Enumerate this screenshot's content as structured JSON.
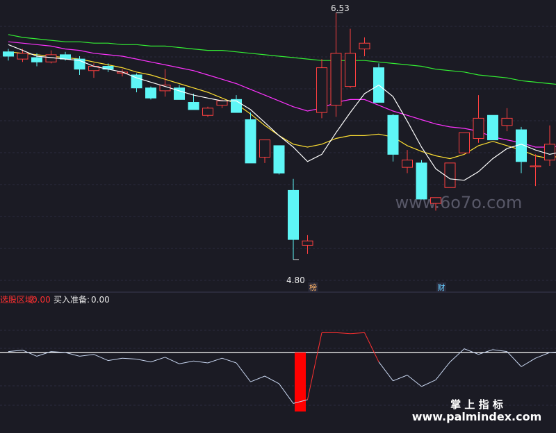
{
  "chart_data": [
    {
      "type": "candlestick",
      "price_high_label": "6.53",
      "price_low_label": "4.80",
      "ylim": [
        4.6,
        6.6
      ],
      "colors": {
        "up": "#ff4040",
        "down": "#5ef6f6",
        "ma5": "#ffffff",
        "ma10": "#ffe033",
        "ma20": "#ff33ff",
        "ma60": "#33ee33"
      },
      "candles": [
        {
          "o": 6.26,
          "h": 6.28,
          "l": 6.2,
          "c": 6.23
        },
        {
          "o": 6.21,
          "h": 6.28,
          "l": 6.19,
          "c": 6.25
        },
        {
          "o": 6.22,
          "h": 6.25,
          "l": 6.16,
          "c": 6.19
        },
        {
          "o": 6.19,
          "h": 6.27,
          "l": 6.18,
          "c": 6.24
        },
        {
          "o": 6.24,
          "h": 6.26,
          "l": 6.2,
          "c": 6.21
        },
        {
          "o": 6.21,
          "h": 6.23,
          "l": 6.1,
          "c": 6.14
        },
        {
          "o": 6.13,
          "h": 6.18,
          "l": 6.08,
          "c": 6.16
        },
        {
          "o": 6.16,
          "h": 6.18,
          "l": 6.12,
          "c": 6.14
        },
        {
          "o": 6.12,
          "h": 6.14,
          "l": 6.09,
          "c": 6.12
        },
        {
          "o": 6.1,
          "h": 6.11,
          "l": 5.98,
          "c": 6.01
        },
        {
          "o": 6.01,
          "h": 6.02,
          "l": 5.93,
          "c": 5.94
        },
        {
          "o": 5.99,
          "h": 6.14,
          "l": 5.95,
          "c": 6.03
        },
        {
          "o": 6.01,
          "h": 6.03,
          "l": 5.93,
          "c": 5.93
        },
        {
          "o": 5.91,
          "h": 5.97,
          "l": 5.86,
          "c": 5.86
        },
        {
          "o": 5.82,
          "h": 5.88,
          "l": 5.81,
          "c": 5.87
        },
        {
          "o": 5.89,
          "h": 5.93,
          "l": 5.87,
          "c": 5.92
        },
        {
          "o": 5.93,
          "h": 5.96,
          "l": 5.84,
          "c": 5.84
        },
        {
          "o": 5.79,
          "h": 5.84,
          "l": 5.49,
          "c": 5.49
        },
        {
          "o": 5.53,
          "h": 5.65,
          "l": 5.49,
          "c": 5.65
        },
        {
          "o": 5.61,
          "h": 5.61,
          "l": 5.41,
          "c": 5.42
        },
        {
          "o": 5.3,
          "h": 5.38,
          "l": 4.82,
          "c": 4.96
        },
        {
          "o": 4.92,
          "h": 4.99,
          "l": 4.86,
          "c": 4.95
        },
        {
          "o": 5.84,
          "h": 6.21,
          "l": 5.8,
          "c": 6.15
        },
        {
          "o": 5.89,
          "h": 6.53,
          "l": 5.81,
          "c": 6.25
        },
        {
          "o": 6.02,
          "h": 6.42,
          "l": 6.01,
          "c": 6.25
        },
        {
          "o": 6.28,
          "h": 6.36,
          "l": 6.23,
          "c": 6.32
        },
        {
          "o": 6.15,
          "h": 6.18,
          "l": 5.91,
          "c": 5.91
        },
        {
          "o": 5.82,
          "h": 5.83,
          "l": 5.5,
          "c": 5.55
        },
        {
          "o": 5.46,
          "h": 5.58,
          "l": 5.42,
          "c": 5.51
        },
        {
          "o": 5.49,
          "h": 5.51,
          "l": 5.24,
          "c": 5.24
        },
        {
          "o": 5.21,
          "h": 5.24,
          "l": 5.16,
          "c": 5.25
        },
        {
          "o": 5.32,
          "h": 5.49,
          "l": 5.32,
          "c": 5.49
        },
        {
          "o": 5.56,
          "h": 5.66,
          "l": 5.62,
          "c": 5.7
        },
        {
          "o": 5.66,
          "h": 5.96,
          "l": 5.63,
          "c": 5.8
        },
        {
          "o": 5.82,
          "h": 5.82,
          "l": 5.68,
          "c": 5.65
        },
        {
          "o": 5.75,
          "h": 5.87,
          "l": 5.71,
          "c": 5.8
        },
        {
          "o": 5.72,
          "h": 5.74,
          "l": 5.42,
          "c": 5.5
        },
        {
          "o": 5.47,
          "h": 5.55,
          "l": 5.33,
          "c": 5.47
        },
        {
          "o": 5.51,
          "h": 5.75,
          "l": 5.47,
          "c": 5.62
        },
        {
          "o": 5.66,
          "h": 5.72,
          "l": 5.63,
          "c": 5.69
        }
      ],
      "ma5": [
        6.31,
        6.27,
        6.23,
        6.22,
        6.21,
        6.2,
        6.16,
        6.14,
        6.12,
        6.08,
        6.05,
        6.02,
        5.99,
        5.96,
        5.94,
        5.92,
        5.92,
        5.86,
        5.77,
        5.68,
        5.6,
        5.5,
        5.55,
        5.7,
        5.84,
        5.97,
        6.03,
        5.95,
        5.78,
        5.6,
        5.45,
        5.38,
        5.37,
        5.43,
        5.52,
        5.59,
        5.62,
        5.58,
        5.55,
        5.57
      ],
      "ma10": [
        6.26,
        6.25,
        6.24,
        6.23,
        6.22,
        6.21,
        6.19,
        6.17,
        6.15,
        6.12,
        6.1,
        6.07,
        6.04,
        6.01,
        5.98,
        5.94,
        5.9,
        5.83,
        5.75,
        5.68,
        5.62,
        5.6,
        5.62,
        5.66,
        5.68,
        5.68,
        5.69,
        5.67,
        5.61,
        5.57,
        5.54,
        5.52,
        5.55,
        5.61,
        5.64,
        5.61,
        5.58,
        5.54,
        5.52,
        5.55
      ],
      "ma20": [
        6.33,
        6.32,
        6.31,
        6.3,
        6.28,
        6.27,
        6.25,
        6.24,
        6.23,
        6.21,
        6.19,
        6.17,
        6.15,
        6.13,
        6.1,
        6.07,
        6.04,
        6.0,
        5.96,
        5.92,
        5.88,
        5.85,
        5.87,
        5.91,
        5.93,
        5.93,
        5.89,
        5.85,
        5.82,
        5.79,
        5.76,
        5.74,
        5.73,
        5.71,
        5.67,
        5.65,
        5.63,
        5.6,
        5.6,
        5.61
      ],
      "ma60": [
        6.38,
        6.36,
        6.35,
        6.34,
        6.33,
        6.33,
        6.32,
        6.32,
        6.31,
        6.31,
        6.3,
        6.3,
        6.29,
        6.28,
        6.27,
        6.27,
        6.26,
        6.25,
        6.24,
        6.23,
        6.22,
        6.21,
        6.2,
        6.2,
        6.2,
        6.2,
        6.19,
        6.18,
        6.17,
        6.16,
        6.14,
        6.13,
        6.12,
        6.1,
        6.09,
        6.08,
        6.06,
        6.05,
        6.04,
        6.03
      ],
      "markers": [
        {
          "index": 21,
          "label": "榜",
          "color": "#ffb366"
        },
        {
          "index": 30,
          "label": "财",
          "color": "#66ccff"
        }
      ],
      "watermark": "www.6o7o.com"
    },
    {
      "type": "line",
      "legend": [
        {
          "label": "选股区域:",
          "value": "0.00",
          "color": "#ff3030"
        },
        {
          "label": "买入准备:",
          "value": "0.00",
          "color": "#e8e8e8"
        }
      ],
      "baseline": 0,
      "ylim": [
        -1.5,
        1.0
      ],
      "values": [
        0.02,
        0.05,
        -0.08,
        0.02,
        0.0,
        -0.08,
        -0.04,
        -0.17,
        -0.12,
        -0.14,
        -0.2,
        -0.1,
        -0.24,
        -0.18,
        -0.22,
        -0.12,
        -0.22,
        -0.62,
        -0.5,
        -0.66,
        -1.08,
        -1.0,
        0.42,
        0.42,
        0.4,
        0.42,
        -0.2,
        -0.6,
        -0.48,
        -0.72,
        -0.58,
        -0.2,
        0.08,
        -0.04,
        0.06,
        0.02,
        -0.3,
        -0.12,
        0.0,
        0.02
      ],
      "signal_bar": {
        "index": 20,
        "value": -1.25,
        "color": "#ff0000"
      },
      "watermark_title": "掌 上 指 标",
      "watermark_url": "www.palmindex.com"
    }
  ]
}
